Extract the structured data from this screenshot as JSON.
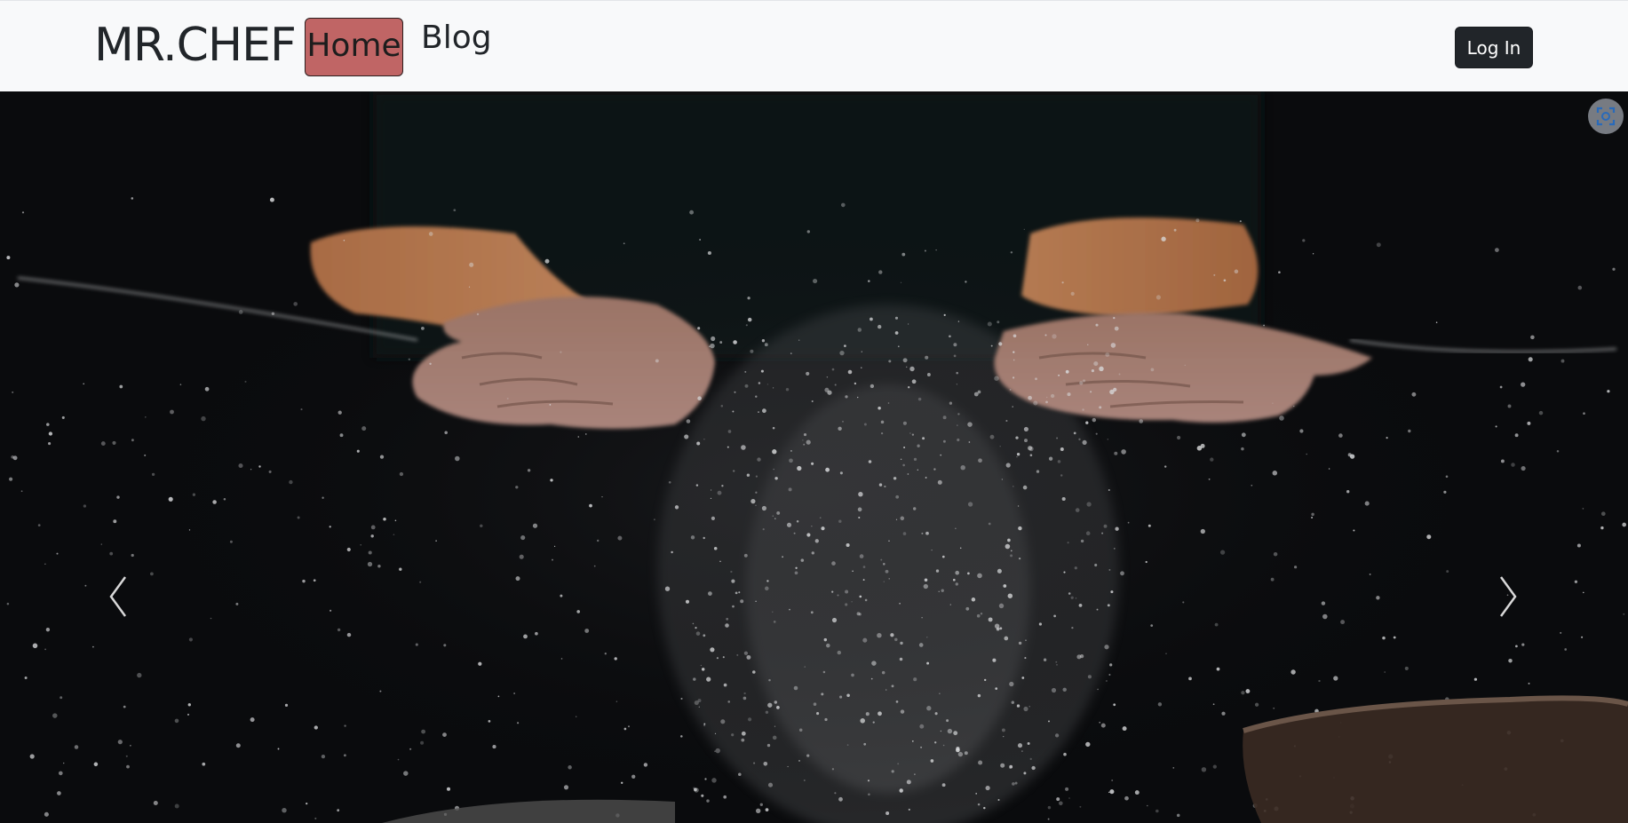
{
  "navbar": {
    "brand": "MR.CHEF",
    "links": [
      {
        "label": "Home",
        "active": true
      },
      {
        "label": "Blog",
        "active": false
      }
    ],
    "login_label": "Log In"
  },
  "hero": {
    "image": "chef-hands-flour-photo",
    "prev_icon": "chevron-left-icon",
    "next_icon": "chevron-right-icon",
    "overlay_icon": "screen-capture-icon"
  },
  "colors": {
    "navbar_bg": "#f8f9fa",
    "active_link_bg": "#c06565",
    "login_bg": "#212529",
    "hero_bg": "#090a0c"
  }
}
